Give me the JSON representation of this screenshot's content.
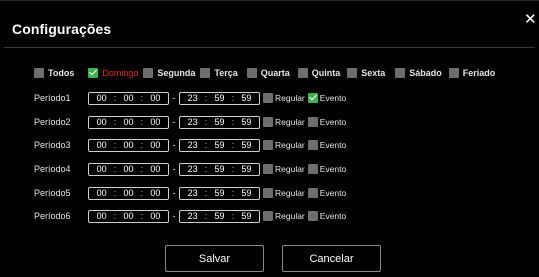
{
  "dialog": {
    "title": "Configurações",
    "close_icon": "close-icon"
  },
  "days": [
    {
      "label": "Todos",
      "checked": false
    },
    {
      "label": "Domingo",
      "checked": true
    },
    {
      "label": "Segunda",
      "checked": false
    },
    {
      "label": "Terça",
      "checked": false
    },
    {
      "label": "Quarta",
      "checked": false
    },
    {
      "label": "Quinta",
      "checked": false
    },
    {
      "label": "Sexta",
      "checked": false
    },
    {
      "label": "Sábado",
      "checked": false
    },
    {
      "label": "Feriado",
      "checked": false
    }
  ],
  "periods": [
    {
      "label": "Período1",
      "start": [
        "00",
        "00",
        "00"
      ],
      "end": [
        "23",
        "59",
        "59"
      ],
      "regular": false,
      "evento": true
    },
    {
      "label": "Período2",
      "start": [
        "00",
        "00",
        "00"
      ],
      "end": [
        "23",
        "59",
        "59"
      ],
      "regular": false,
      "evento": false
    },
    {
      "label": "Período3",
      "start": [
        "00",
        "00",
        "00"
      ],
      "end": [
        "23",
        "59",
        "59"
      ],
      "regular": false,
      "evento": false
    },
    {
      "label": "Período4",
      "start": [
        "00",
        "00",
        "00"
      ],
      "end": [
        "23",
        "59",
        "59"
      ],
      "regular": false,
      "evento": false
    },
    {
      "label": "Período5",
      "start": [
        "00",
        "00",
        "00"
      ],
      "end": [
        "23",
        "59",
        "59"
      ],
      "regular": false,
      "evento": false
    },
    {
      "label": "Período6",
      "start": [
        "00",
        "00",
        "00"
      ],
      "end": [
        "23",
        "59",
        "59"
      ],
      "regular": false,
      "evento": false
    }
  ],
  "options": {
    "regular_label": "Regular",
    "evento_label": "Evento",
    "range_separator": "-",
    "time_separator": ":"
  },
  "buttons": {
    "save_label": "Salvar",
    "cancel_label": "Cancelar"
  },
  "colors": {
    "checked": "#3bb54a",
    "unchecked": "#6e6e6e",
    "selected_day_text": "#d9281c"
  }
}
